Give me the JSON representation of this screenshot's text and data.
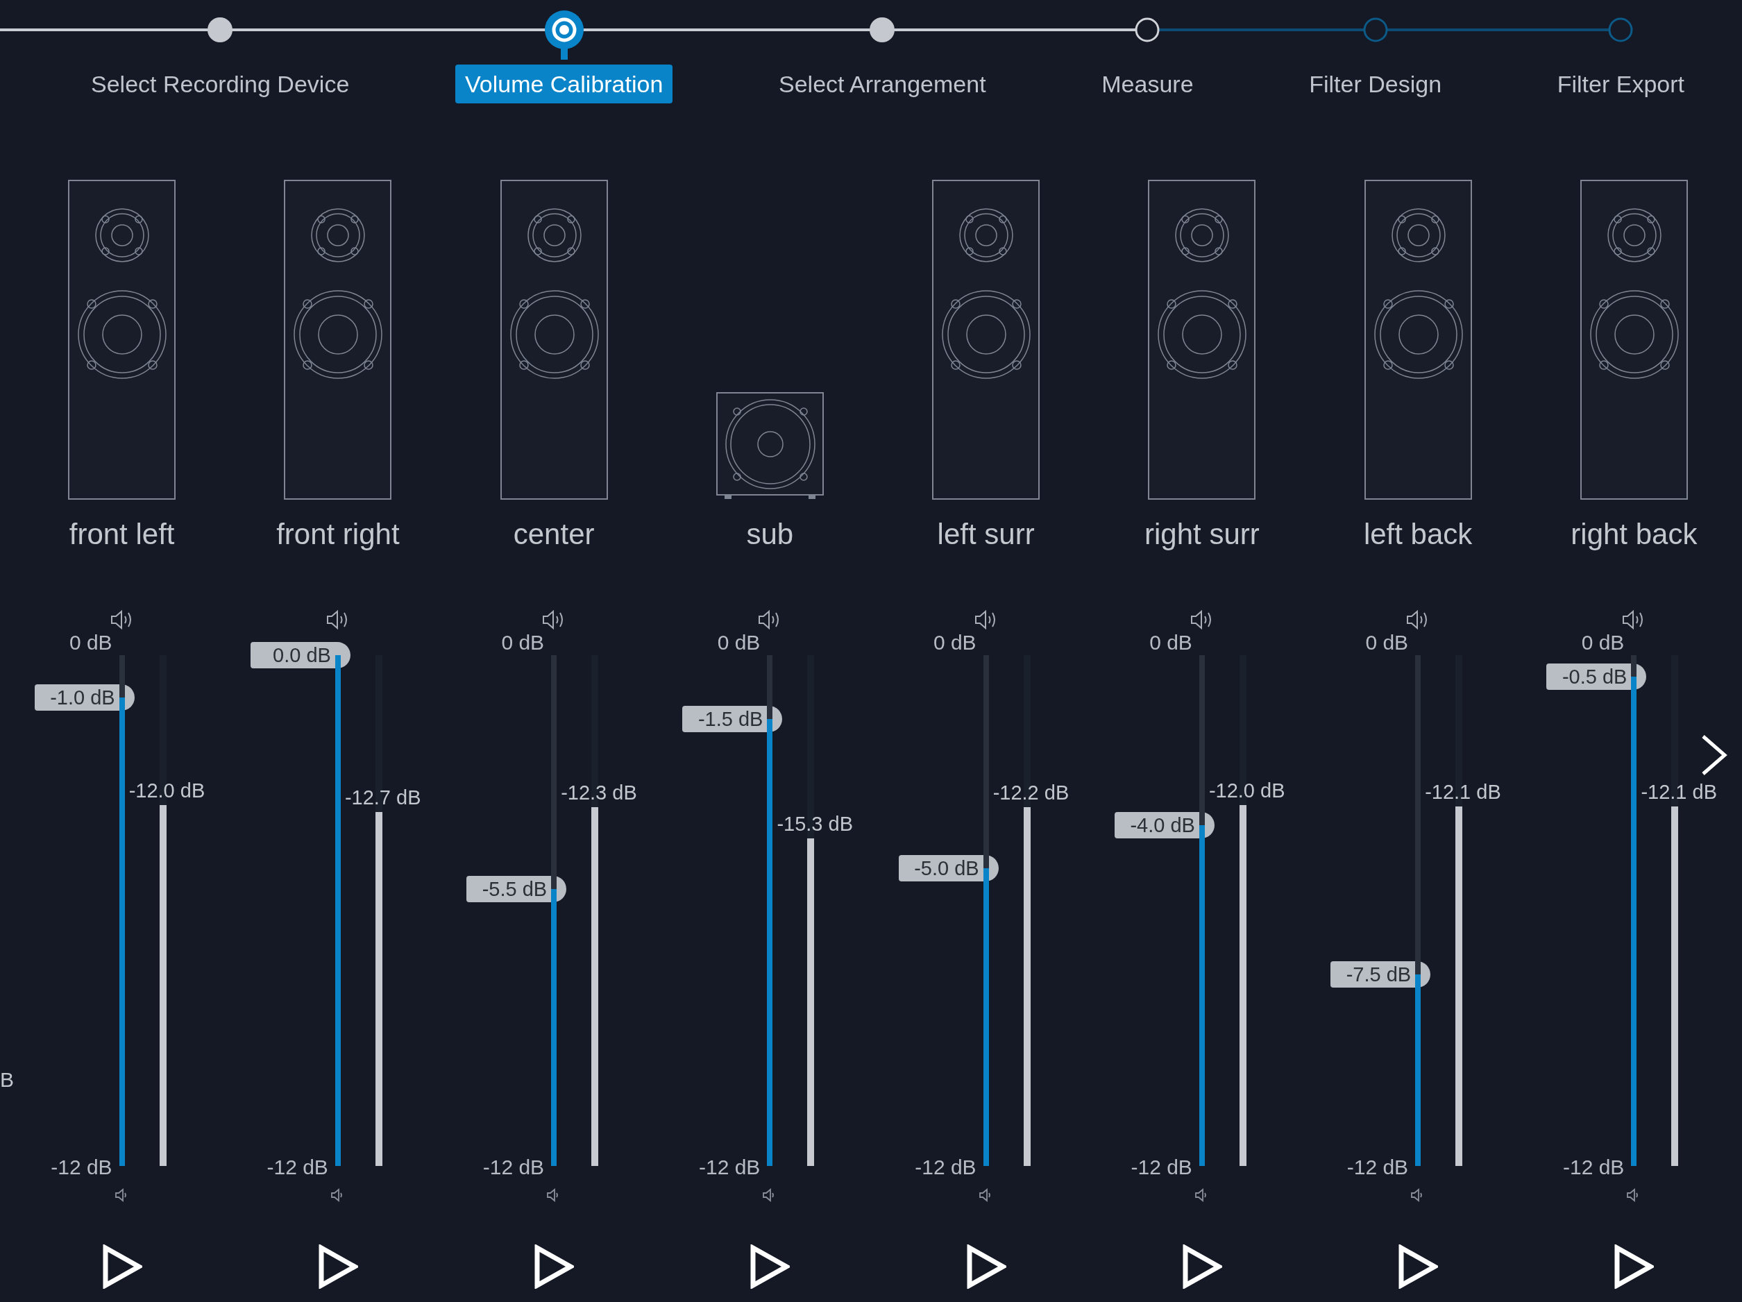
{
  "steps": [
    {
      "label": "Select Recording Device",
      "kind": "done"
    },
    {
      "label": "Volume Calibration",
      "kind": "current"
    },
    {
      "label": "Select Arrangement",
      "kind": "done"
    },
    {
      "label": "Measure",
      "kind": "next"
    },
    {
      "label": "Filter Design",
      "kind": "pending"
    },
    {
      "label": "Filter Export",
      "kind": "pending"
    }
  ],
  "edge_label": "B",
  "channels": [
    {
      "name": "front left",
      "kind": "tower",
      "scale_top": "0 dB",
      "scale_bottom": "-12 dB",
      "gain": "-1.0 dB",
      "level": 0.917,
      "meter": {
        "level": 0.707,
        "reading": "-12.0 dB"
      }
    },
    {
      "name": "front right",
      "kind": "tower",
      "scale_bottom": "-12 dB",
      "gain": "0.0 dB",
      "level": 1.0,
      "meter": {
        "level": 0.693,
        "reading": "-12.7 dB"
      }
    },
    {
      "name": "center",
      "kind": "tower",
      "scale_top": "0 dB",
      "scale_bottom": "-12 dB",
      "gain": "-5.5 dB",
      "level": 0.542,
      "meter": {
        "level": 0.702,
        "reading": "-12.3 dB"
      }
    },
    {
      "name": "sub",
      "kind": "sub",
      "scale_top": "0 dB",
      "scale_bottom": "-12 dB",
      "gain": "-1.5 dB",
      "level": 0.875,
      "meter": {
        "level": 0.641,
        "reading": "-15.3 dB"
      }
    },
    {
      "name": "left surr",
      "kind": "tower",
      "scale_top": "0 dB",
      "scale_bottom": "-12 dB",
      "gain": "-5.0 dB",
      "level": 0.583,
      "meter": {
        "level": 0.702,
        "reading": "-12.2 dB"
      }
    },
    {
      "name": "right surr",
      "kind": "tower",
      "scale_top": "0 dB",
      "scale_bottom": "-12 dB",
      "gain": "-4.0 dB",
      "level": 0.667,
      "meter": {
        "level": 0.707,
        "reading": "-12.0 dB"
      }
    },
    {
      "name": "left back",
      "kind": "tower",
      "scale_top": "0 dB",
      "scale_bottom": "-12 dB",
      "gain": "-7.5 dB",
      "level": 0.375,
      "meter": {
        "level": 0.704,
        "reading": "-12.1 dB"
      }
    },
    {
      "name": "right back",
      "kind": "tower",
      "scale_top": "0 dB",
      "scale_bottom": "-12 dB",
      "gain": "-0.5 dB",
      "level": 0.958,
      "meter": {
        "level": 0.704,
        "reading": "-12.1 dB"
      }
    }
  ]
}
